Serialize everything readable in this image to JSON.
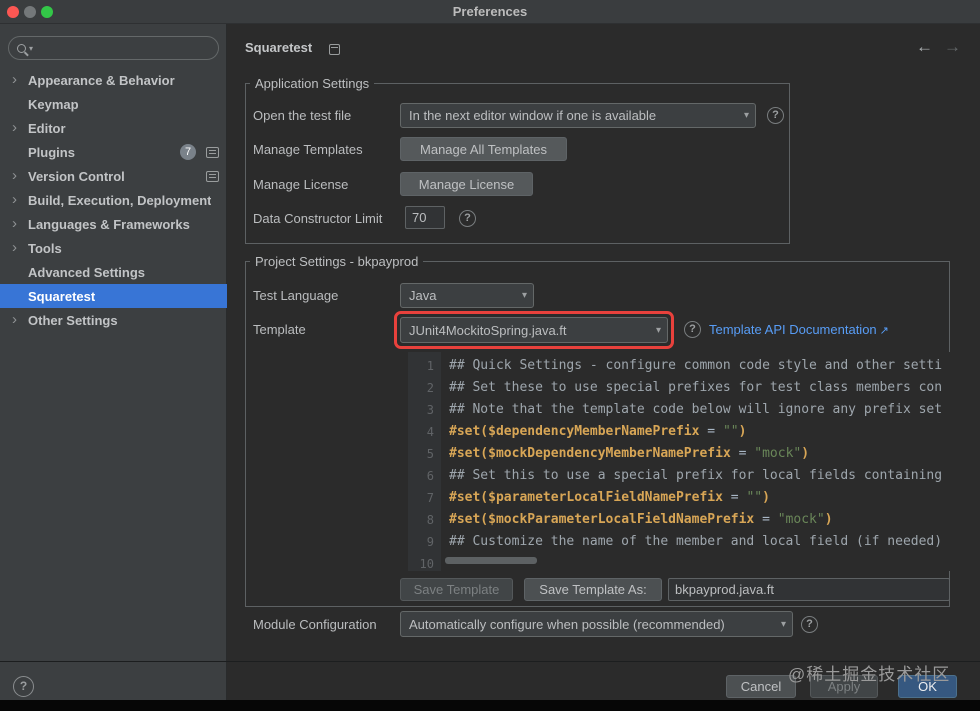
{
  "window": {
    "title": "Preferences"
  },
  "icons": {
    "chevron": "›",
    "dropdown_arrow": "▾",
    "search_caret": "▾",
    "help": "?",
    "back": "←",
    "forward": "→",
    "external": "↗"
  },
  "colors": {
    "selection_blue": "#3875D6",
    "annotation_red": "#E8413C",
    "link_blue": "#589DF6",
    "ok_button_blue": "#365880",
    "string_green": "#6A8759",
    "directive_orange": "#D8A656",
    "comment_gray": "#9EA6AD"
  },
  "sidebar": {
    "search_placeholder": "",
    "items": [
      {
        "label": "Appearance & Behavior"
      },
      {
        "label": "Keymap"
      },
      {
        "label": "Editor"
      },
      {
        "label": "Plugins",
        "badge": "7"
      },
      {
        "label": "Version Control"
      },
      {
        "label": "Build, Execution, Deployment"
      },
      {
        "label": "Languages & Frameworks"
      },
      {
        "label": "Tools"
      },
      {
        "label": "Advanced Settings"
      },
      {
        "label": "Squaretest"
      },
      {
        "label": "Other Settings"
      }
    ]
  },
  "header": {
    "breadcrumb": "Squaretest"
  },
  "application_settings": {
    "group_title": "Application Settings",
    "open_test_file_label": "Open the test file",
    "open_test_file_value": "In the next editor window if one is available",
    "manage_templates_label": "Manage Templates",
    "manage_templates_button": "Manage All Templates",
    "manage_license_label": "Manage License",
    "manage_license_button": "Manage License",
    "data_constructor_limit_label": "Data Constructor Limit",
    "data_constructor_limit_value": "70"
  },
  "project_settings": {
    "group_title": "Project Settings - bkpayprod",
    "test_language_label": "Test Language",
    "test_language_value": "Java",
    "template_label": "Template",
    "template_value": "JUnit4MockitoSpring.java.ft",
    "doc_link": "Template API Documentation",
    "save_template_button": "Save Template",
    "save_template_as_button": "Save Template As:",
    "save_template_as_value": "bkpayprod.java.ft",
    "module_configuration_label": "Module Configuration",
    "module_configuration_value": "Automatically configure when possible (recommended)"
  },
  "editor": {
    "lines": [
      {
        "num": "1",
        "segments": [
          {
            "c": "comment",
            "t": "## Quick Settings - configure common code style and other setti"
          }
        ]
      },
      {
        "num": "2",
        "segments": [
          {
            "c": "comment",
            "t": "## Set these to use special prefixes for test class members con"
          }
        ]
      },
      {
        "num": "3",
        "segments": [
          {
            "c": "comment",
            "t": "## Note that the template code below will ignore any prefix set"
          }
        ]
      },
      {
        "num": "4",
        "segments": [
          {
            "c": "kw",
            "t": "#set("
          },
          {
            "c": "var",
            "t": "$dependencyMemberNamePrefix"
          },
          {
            "c": "plain",
            "t": " = "
          },
          {
            "c": "str",
            "t": "\"\""
          },
          {
            "c": "kw",
            "t": ")"
          }
        ]
      },
      {
        "num": "5",
        "segments": [
          {
            "c": "kw",
            "t": "#set("
          },
          {
            "c": "var",
            "t": "$mockDependencyMemberNamePrefix"
          },
          {
            "c": "plain",
            "t": " = "
          },
          {
            "c": "str",
            "t": "\"mock\""
          },
          {
            "c": "kw",
            "t": ")"
          }
        ]
      },
      {
        "num": "6",
        "segments": [
          {
            "c": "comment",
            "t": "## Set this to use a special prefix for local fields containing"
          }
        ]
      },
      {
        "num": "7",
        "segments": [
          {
            "c": "kw",
            "t": "#set("
          },
          {
            "c": "var",
            "t": "$parameterLocalFieldNamePrefix"
          },
          {
            "c": "plain",
            "t": " = "
          },
          {
            "c": "str",
            "t": "\"\""
          },
          {
            "c": "kw",
            "t": ")"
          }
        ]
      },
      {
        "num": "8",
        "segments": [
          {
            "c": "kw",
            "t": "#set("
          },
          {
            "c": "var",
            "t": "$mockParameterLocalFieldNamePrefix"
          },
          {
            "c": "plain",
            "t": " = "
          },
          {
            "c": "str",
            "t": "\"mock\""
          },
          {
            "c": "kw",
            "t": ")"
          }
        ]
      },
      {
        "num": "9",
        "segments": [
          {
            "c": "comment",
            "t": "## Customize the name of the member and local field (if needed)"
          }
        ]
      },
      {
        "num": "10",
        "segments": []
      }
    ]
  },
  "footer": {
    "cancel": "Cancel",
    "apply": "Apply",
    "ok": "OK",
    "watermark": "@稀土掘金技术社区"
  }
}
